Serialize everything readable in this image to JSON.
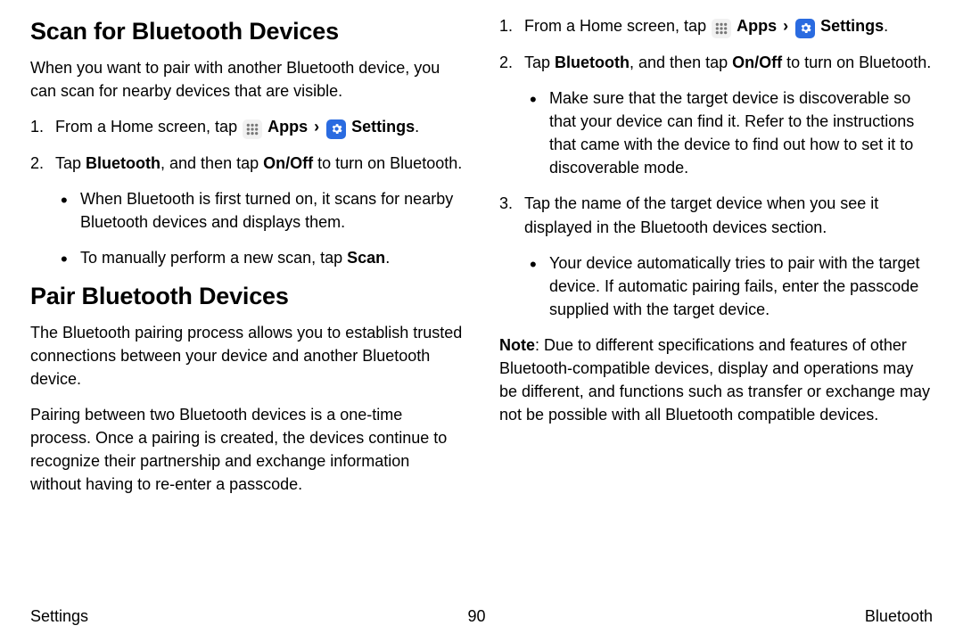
{
  "left": {
    "heading1": "Scan for Bluetooth Devices",
    "intro1": "When you want to pair with another Bluetooth device, you can scan for nearby devices that are visible.",
    "step1_prefix": "From a Home screen, tap",
    "apps_label": "Apps",
    "settings_label": "Settings",
    "step1_suffix": ".",
    "step2_a": "Tap ",
    "step2_bt": "Bluetooth",
    "step2_b": ", and then tap ",
    "step2_onoff": "On/Off",
    "step2_c": " to turn on Bluetooth.",
    "bullet1": "When Bluetooth is first turned on, it scans for nearby Bluetooth devices and displays them.",
    "bullet2_a": "To manually perform a new scan, tap ",
    "bullet2_scan": "Scan",
    "bullet2_b": ".",
    "heading2": "Pair Bluetooth Devices",
    "pair_p1": "The Bluetooth pairing process allows you to establish trusted connections between your device and another Bluetooth device.",
    "pair_p2": "Pairing between two Bluetooth devices is a one-time process. Once a pairing is created, the devices continue to recognize their partnership and exchange information without having to re-enter a passcode."
  },
  "right": {
    "step1_prefix": "From a Home screen, tap",
    "apps_label": "Apps",
    "settings_label": "Settings",
    "step1_suffix": ".",
    "step2_a": "Tap ",
    "step2_bt": "Bluetooth",
    "step2_b": ", and then tap ",
    "step2_onoff": "On/Off",
    "step2_c": " to turn on Bluetooth.",
    "bullet1": "Make sure that the target device is discoverable so that your device can find it. Refer to the instructions that came with the device to find out how to set it to discoverable mode.",
    "step3": "Tap the name of the target device when you see it displayed in the Bluetooth devices section.",
    "bullet2": "Your device automatically tries to pair with the target device. If automatic pairing fails, enter the passcode supplied with the target device.",
    "note_label": "Note",
    "note_body": ": Due to different specifications and features of other Bluetooth-compatible devices, display and operations may be different, and functions such as transfer or exchange may not be possible with all Bluetooth compatible devices."
  },
  "footer": {
    "left": "Settings",
    "center": "90",
    "right": "Bluetooth"
  },
  "chevron": "›"
}
